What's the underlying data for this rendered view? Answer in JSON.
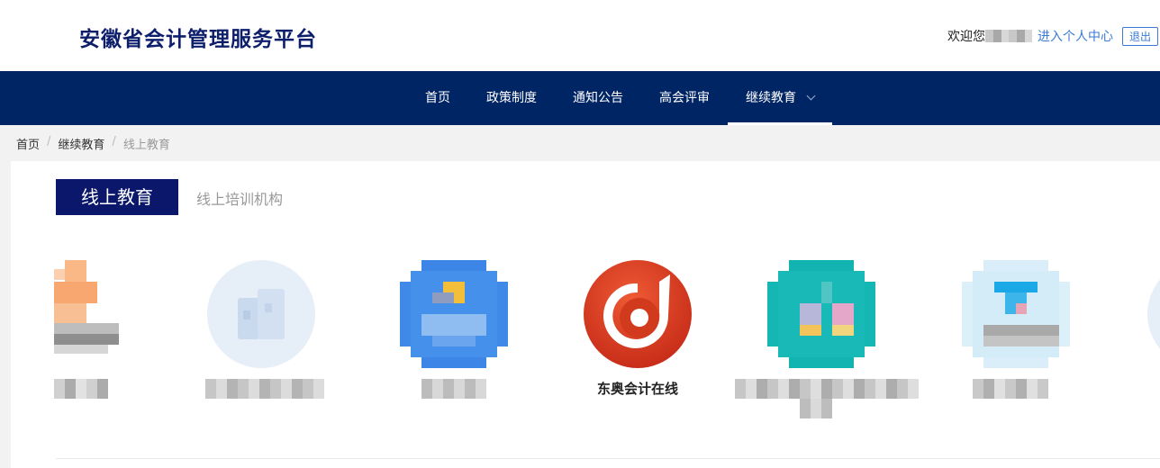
{
  "header": {
    "site_title": "安徽省会计管理服务平台",
    "welcome": "欢迎您",
    "profile_link": "进入个人中心",
    "logout": "退出"
  },
  "nav": {
    "items": [
      {
        "label": "首页"
      },
      {
        "label": "政策制度"
      },
      {
        "label": "通知公告"
      },
      {
        "label": "高会评审"
      },
      {
        "label": "继续教育"
      }
    ],
    "active_index": 4
  },
  "breadcrumb": [
    "首页",
    "继续教育",
    "线上教育"
  ],
  "breadcrumb_sep": "/",
  "tabs": {
    "active": "线上教育",
    "inactive": "线上培训机构"
  },
  "organizations": [
    {
      "name": "东奥会计在线",
      "logo": "dongao-logo",
      "brand_color": "#d9341e"
    }
  ],
  "colors": {
    "nav_bg": "#002565",
    "title_color": "#0d1f6b",
    "tab_active_bg": "#0a176a",
    "link_color": "#3a7bd5"
  }
}
